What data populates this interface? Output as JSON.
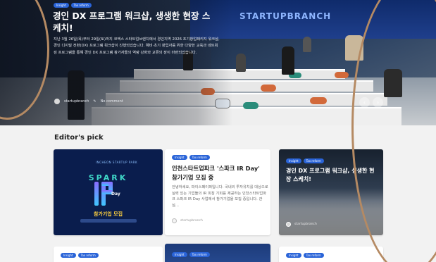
{
  "hero": {
    "tags": [
      "Insight",
      "Tax reform"
    ],
    "title": "경인 DX 프로그램 워크샵, 생생한 현장 스케치!",
    "excerpt": "지난 3월 26일(목)부터 29일(토)까지 코엑스 스타트업브랜치에서 경인지역 2026 조기창업패키지 워크샵, 경인 디지털 전환(DX) 프로그램 워크샵이 진행되었습니다. 예비·초기 창업자를 위한 다양한 교육과 네트워킹 프로그램을 통해 경인 DX 프로그램 참가자들의 역량 강화와 교류의 장이 마련되었습니다.",
    "author": "startupbranch",
    "meta_extra": "No comment",
    "brand_sign": "STARTUPBRANCH",
    "prev_arrow": "‹",
    "next_arrow": "›"
  },
  "section": {
    "title": "Editor's pick"
  },
  "cards": [
    {
      "spark_top": "INCHEON STARTUP PARK",
      "spark_word": "SPARK",
      "spark_day": "Day",
      "spark_recruit": "참가기업 모집"
    },
    {
      "tags": [
        "Insight",
        "Tax reform"
      ],
      "title": "인천스타트업파크 '스파크 IR Day' 참가기업 모집 중",
      "excerpt": "안녕하세요, 파이스페이퍼입니다. 국내외 투자유치를 대상으로 실력 있는 기업들의 IR 피칭 기회를 제공하는 인천스타트업파크 스파크 IR Day 사업에서 참가기업을 모집 중입니다. 관심...",
      "author": "startupbranch"
    },
    {
      "tags": [
        "Insight",
        "Tax reform"
      ],
      "title": "경인 DX 프로그램 워크샵, 생생한 현장 스케치!",
      "author": "startupbranch"
    },
    {
      "tags": [
        "Insight",
        "Tax reform"
      ]
    },
    {
      "tags": [
        "Insight",
        "Tax reform"
      ]
    },
    {
      "tags": [
        "Insight",
        "Tax reform"
      ]
    }
  ],
  "colors": {
    "tag": "#2a64d8",
    "accent": "#ffd23f",
    "spark": "#3fd8c8"
  }
}
